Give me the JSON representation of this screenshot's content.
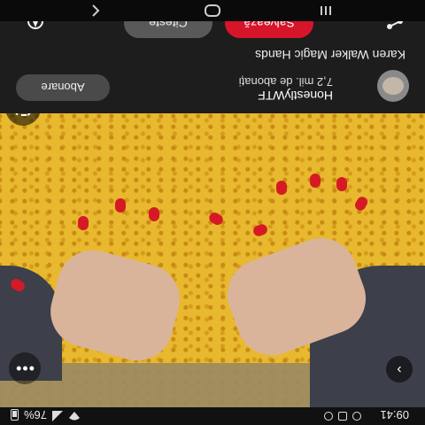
{
  "status_bar": {
    "time": "09:41",
    "battery_percent": "76%",
    "icons": [
      "notification-icon",
      "message-icon",
      "alarm-icon",
      "wifi-icon",
      "signal-icon",
      "battery-icon"
    ]
  },
  "pin": {
    "more_icon": "chevron-icon",
    "options_icon": "more-dots-icon",
    "lens_icon": "visual-search-icon"
  },
  "creator": {
    "name": "HonestlyWTF",
    "followers": "7,2 mil. de abonați",
    "follow_label": "Abonare"
  },
  "pin_title": "Karen Walker Magic Hands",
  "actions": {
    "read_label": "Citește",
    "save_label": "Salvează",
    "save_color": "#d7152a"
  },
  "nav_bar": {
    "buttons": [
      "recent-apps-icon",
      "home-icon",
      "back-icon"
    ]
  }
}
